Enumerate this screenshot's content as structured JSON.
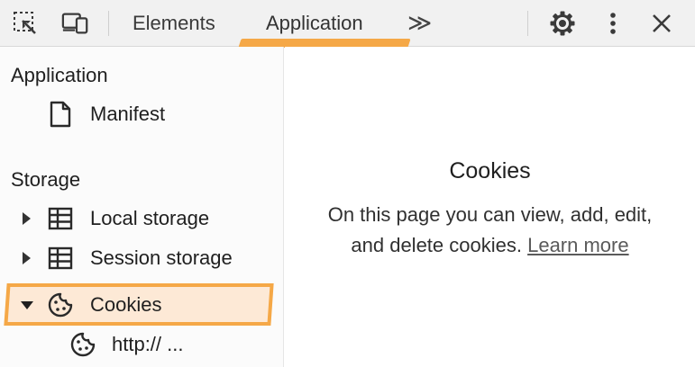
{
  "toolbar": {
    "tabs": [
      {
        "label": "Elements"
      },
      {
        "label": "Application"
      }
    ],
    "more_tabs_label": "≫",
    "icons": [
      "inspect-icon",
      "device-toggle-icon",
      "settings-gear-icon",
      "more-vert-icon",
      "close-icon"
    ],
    "accent_color": "#f5a847"
  },
  "sidebar": {
    "application_section": {
      "title": "Application",
      "items": [
        {
          "label": "Manifest",
          "icon": "document-icon"
        }
      ]
    },
    "storage_section": {
      "title": "Storage",
      "items": [
        {
          "label": "Local storage",
          "icon": "table-icon",
          "expanded": false
        },
        {
          "label": "Session storage",
          "icon": "table-icon",
          "expanded": false
        },
        {
          "label": "Cookies",
          "icon": "cookie-icon",
          "expanded": true,
          "selected": true
        }
      ],
      "cookie_children": [
        {
          "label": "http:// ...",
          "icon": "cookie-icon"
        }
      ]
    }
  },
  "main": {
    "title": "Cookies",
    "description_line1": "On this page you can view, add, edit,",
    "description_line2": "and delete cookies.",
    "learn_more_label": "Learn more"
  }
}
